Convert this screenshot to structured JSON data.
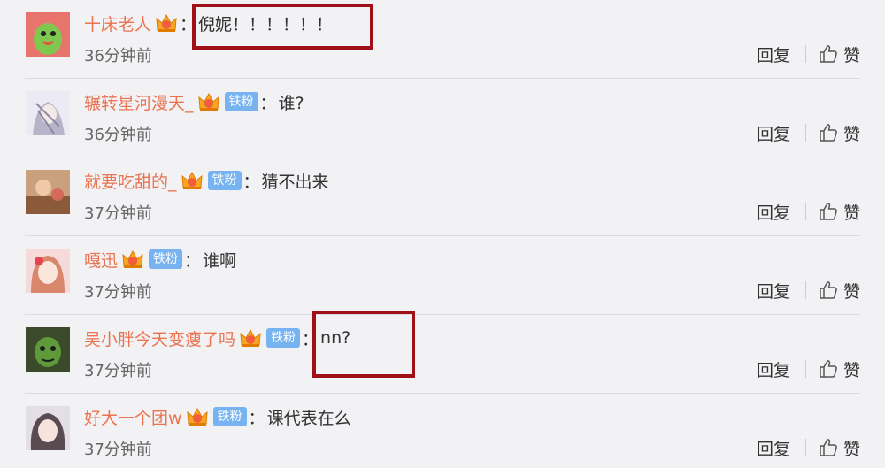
{
  "comments": [
    {
      "username": "十床老人",
      "has_badge": false,
      "badge": "",
      "comment": "倪妮！！！！！！",
      "time": "36分钟前",
      "reply_label": "回复",
      "like_label": "赞"
    },
    {
      "username": "辗转星河漫天_",
      "has_badge": true,
      "badge": "铁粉",
      "comment": "谁?",
      "time": "36分钟前",
      "reply_label": "回复",
      "like_label": "赞"
    },
    {
      "username": "就要吃甜的_",
      "has_badge": true,
      "badge": "铁粉",
      "comment": "猜不出来",
      "time": "37分钟前",
      "reply_label": "回复",
      "like_label": "赞"
    },
    {
      "username": "嘎迅",
      "has_badge": true,
      "badge": "铁粉",
      "comment": "谁啊",
      "time": "37分钟前",
      "reply_label": "回复",
      "like_label": "赞"
    },
    {
      "username": "吴小胖今天变瘦了吗",
      "has_badge": true,
      "badge": "铁粉",
      "comment": "nn?",
      "time": "37分钟前",
      "reply_label": "回复",
      "like_label": "赞"
    },
    {
      "username": "好大一个团w",
      "has_badge": true,
      "badge": "铁粉",
      "comment": "课代表在么",
      "time": "37分钟前",
      "reply_label": "回复",
      "like_label": "赞"
    }
  ],
  "colon": "：",
  "colors": {
    "username": "#eb7350",
    "badge_bg": "#76b3f0",
    "highlight_border": "#a01018",
    "background": "#f2f2f5"
  },
  "icons": {
    "crown": "vip-crown-icon",
    "like": "thumbs-up-icon"
  }
}
